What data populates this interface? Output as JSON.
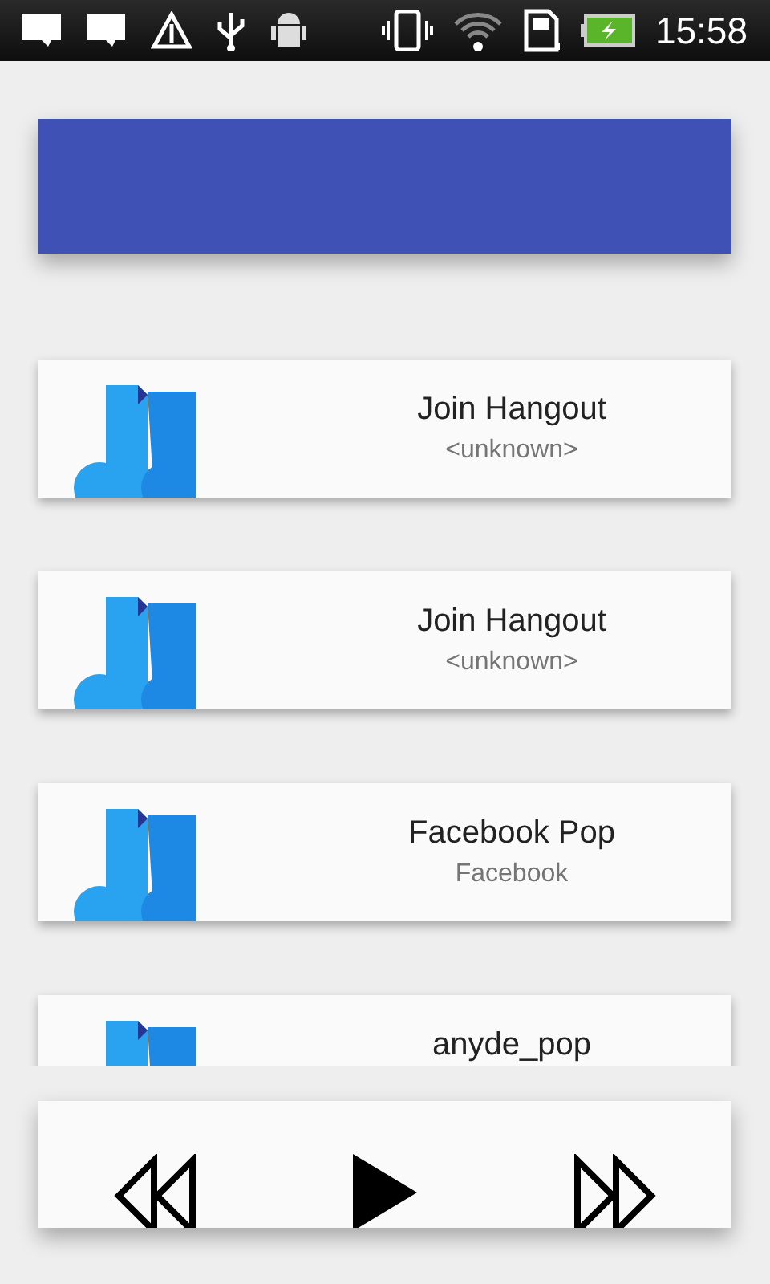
{
  "status_bar": {
    "time": "15:58"
  },
  "songs": [
    {
      "title": "Join Hangout",
      "artist": "<unknown>"
    },
    {
      "title": "Join Hangout",
      "artist": "<unknown>"
    },
    {
      "title": "Facebook Pop",
      "artist": "Facebook"
    },
    {
      "title": "anyde_pop"
    }
  ]
}
